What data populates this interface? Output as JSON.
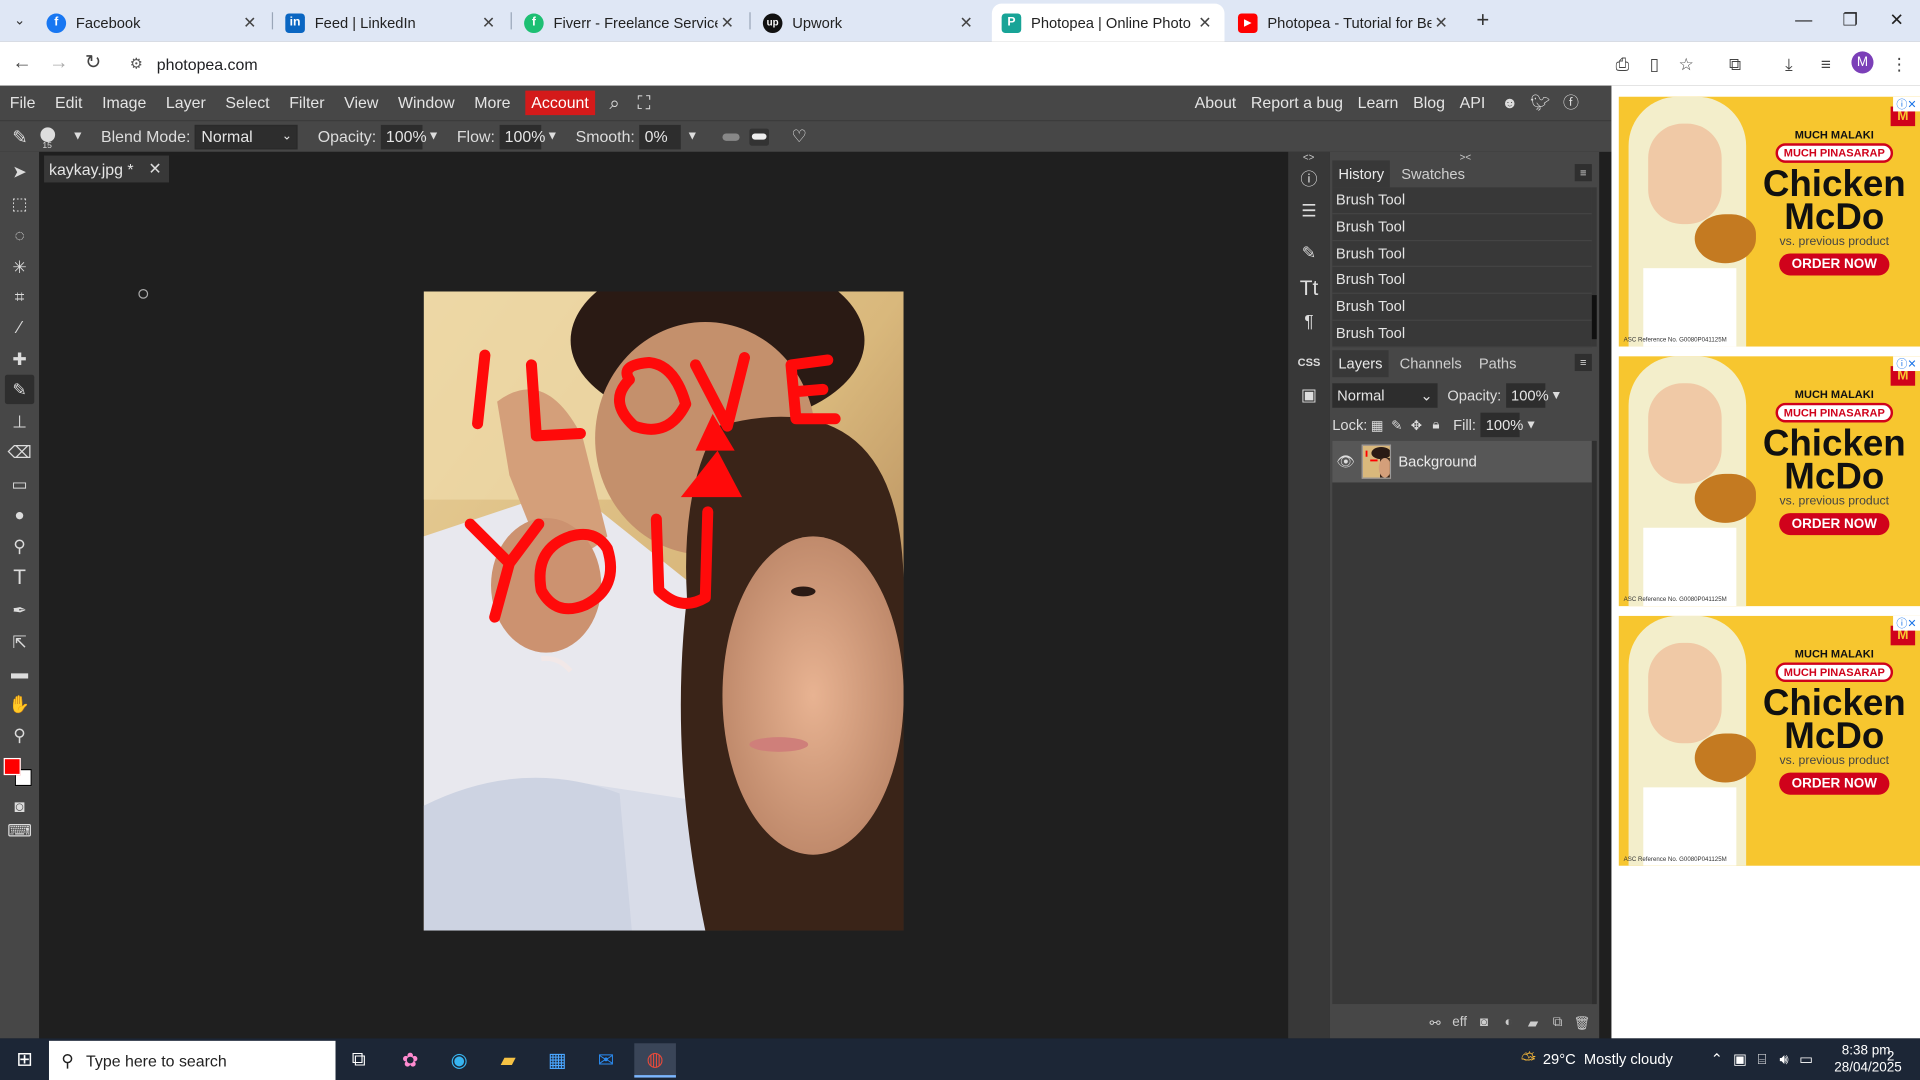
{
  "browser": {
    "tabs": [
      {
        "title": "Facebook",
        "icon": "facebook-icon",
        "color": "#1877f2",
        "glyph": "f"
      },
      {
        "title": "Feed | LinkedIn",
        "icon": "linkedin-icon",
        "color": "#0a66c2",
        "glyph": "in"
      },
      {
        "title": "Fiverr - Freelance Services Mark",
        "icon": "fiverr-icon",
        "color": "#1dbf73",
        "glyph": "fi"
      },
      {
        "title": "Upwork",
        "icon": "upwork-icon",
        "color": "#111111",
        "glyph": "up"
      },
      {
        "title": "Photopea | Online Photo Editor",
        "icon": "photopea-icon",
        "color": "#18a497",
        "glyph": "P"
      },
      {
        "title": "Photopea - Tutorial for Beginne",
        "icon": "youtube-icon",
        "color": "#ff0000",
        "glyph": "▶"
      }
    ],
    "active_tab": 4,
    "url": "photopea.com"
  },
  "photopea": {
    "menu": [
      "File",
      "Edit",
      "Image",
      "Layer",
      "Select",
      "Filter",
      "View",
      "Window",
      "More"
    ],
    "account_label": "Account",
    "right_links": [
      "About",
      "Report a bug",
      "Learn",
      "Blog",
      "API"
    ],
    "options": {
      "brush_size": "15",
      "blend_mode_label": "Blend Mode:",
      "blend_mode_value": "Normal",
      "opacity_label": "Opacity:",
      "opacity_value": "100%",
      "flow_label": "Flow:",
      "flow_value": "100%",
      "smooth_label": "Smooth:",
      "smooth_value": "0%"
    },
    "document_tab": "kaykay.jpg *",
    "history": {
      "tabs": [
        "History",
        "Swatches"
      ],
      "items": [
        "Brush Tool",
        "Brush Tool",
        "Brush Tool",
        "Brush Tool",
        "Brush Tool",
        "Brush Tool"
      ]
    },
    "layers": {
      "tabs": [
        "Layers",
        "Channels",
        "Paths"
      ],
      "blend": "Normal",
      "opacity_label": "Opacity:",
      "opacity_value": "100%",
      "lock_label": "Lock:",
      "fill_label": "Fill:",
      "fill_value": "100%",
      "items": [
        {
          "name": "Background",
          "visible": true
        }
      ]
    },
    "colors": {
      "foreground": "#ff0000",
      "background": "#ffffff"
    },
    "canvas_text": "I LOVE YOU"
  },
  "ads": {
    "headline_small": "MUCH MALAKI",
    "pill": "MUCH PINASARAP",
    "headline": "Chicken McDo",
    "vs": "vs. previous product",
    "cta": "ORDER NOW",
    "ref": "ASC Reference No. G0080P041125M"
  },
  "taskbar": {
    "search_placeholder": "Type here to search",
    "weather": "29°C  Mostly cloudy",
    "time": "8:38 pm",
    "date": "28/04/2025",
    "notifications": "2"
  }
}
